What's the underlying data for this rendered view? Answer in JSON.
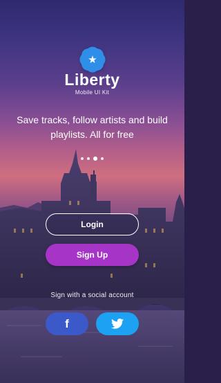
{
  "brand": {
    "logo_icon": "star-badge-icon",
    "title": "Liberty",
    "subtitle": "Mobile UI Kit"
  },
  "onboarding": {
    "tagline": "Save tracks, follow artists and build playlists. All for free",
    "pages": 4,
    "active_page": 2
  },
  "actions": {
    "login_label": "Login",
    "signup_label": "Sign Up"
  },
  "social": {
    "label": "Sign with a social account",
    "facebook_icon": "facebook-icon",
    "twitter_icon": "twitter-icon"
  },
  "colors": {
    "logo": "#2f8ee8",
    "signup": "#a634c7",
    "facebook": "#3b59c9",
    "twitter": "#1da1f2"
  }
}
